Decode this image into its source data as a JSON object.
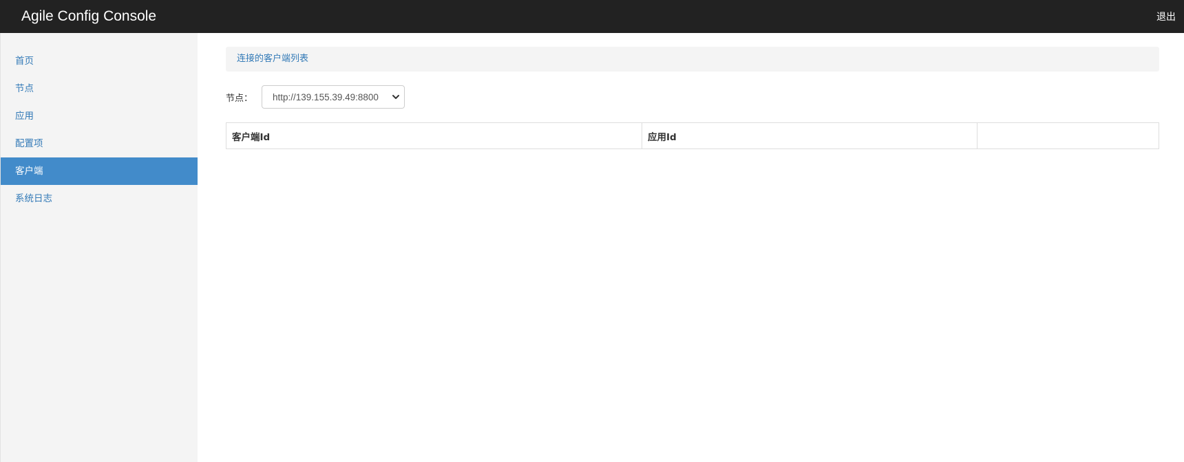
{
  "header": {
    "title": "Agile Config Console",
    "logout_label": "退出"
  },
  "sidebar": {
    "items": [
      {
        "label": "首页",
        "active": false
      },
      {
        "label": "节点",
        "active": false
      },
      {
        "label": "应用",
        "active": false
      },
      {
        "label": "配置项",
        "active": false
      },
      {
        "label": "客户端",
        "active": true
      },
      {
        "label": "系统日志",
        "active": false
      }
    ]
  },
  "main": {
    "panel_title": "连接的客户端列表",
    "node_filter": {
      "label": "节点：",
      "selected": "http://139.155.39.49:8800"
    },
    "table": {
      "columns": [
        "客户端Id",
        "应用Id",
        ""
      ]
    }
  },
  "colors": {
    "topbar_bg": "#222222",
    "sidebar_bg": "#f4f4f4",
    "active_item_bg": "#428bca",
    "link": "#337ab7"
  },
  "icons": {
    "select_arrow": "chevron-down-icon"
  }
}
